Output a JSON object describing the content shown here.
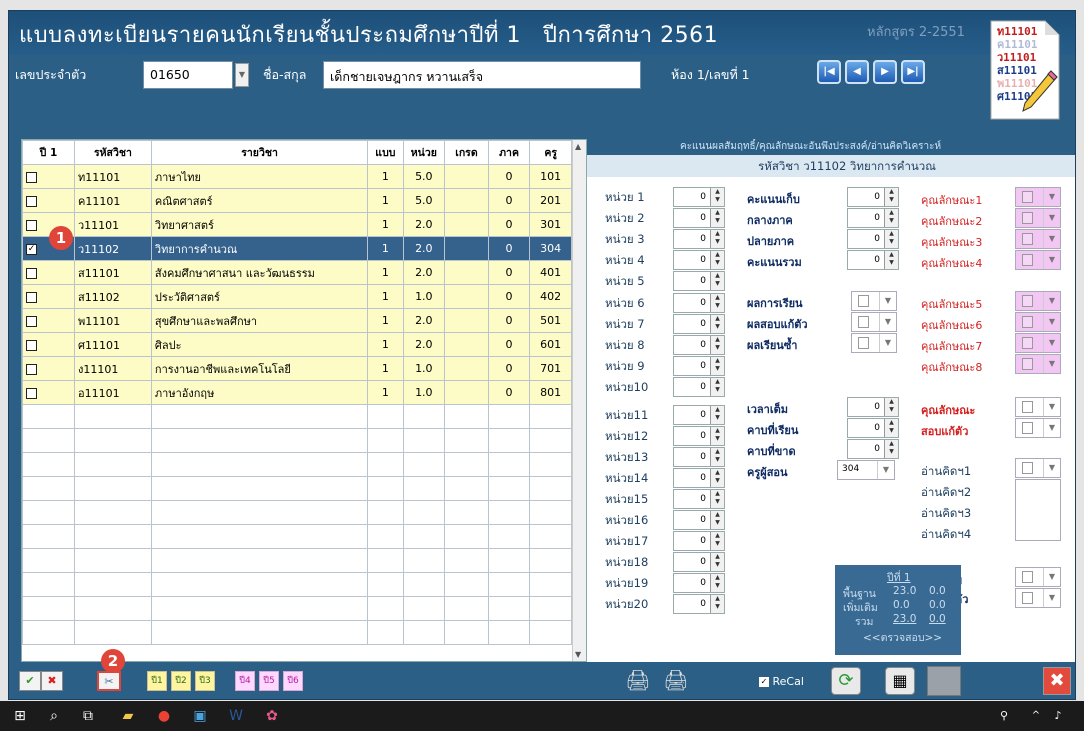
{
  "title": {
    "main": "แบบลงทะเบียนรายคนนักเรียนชั้นประถมศึกษาปีที่ 1",
    "year": "ปีการศึกษา 2561",
    "curriculum": "หลักสูตร 2-2551",
    "logo_lines": [
      "ท11101",
      "ค11101",
      "ว11101",
      "ส11101",
      "พ11101",
      "ศ11101"
    ]
  },
  "student": {
    "id_label": "เลขประจำตัว",
    "id_value": "01650",
    "name_label": "ชื่อ-สกุล",
    "name_value": "เด็กชายเจษฎากร  หวานเสร็จ",
    "room_text": "ห้อง 1/เลขที่ 1"
  },
  "nav": [
    "first",
    "prev",
    "next",
    "last"
  ],
  "grid": {
    "headers": [
      "ปี 1",
      "รหัสวิชา",
      "รายวิชา",
      "แบบ",
      "หน่วย",
      "เกรด",
      "ภาค",
      "ครู"
    ],
    "rows": [
      {
        "checked": false,
        "code": "ท11101",
        "name": "ภาษาไทย",
        "type": "1",
        "credit": "5.0",
        "grade": "",
        "term": "0",
        "teacher": "101"
      },
      {
        "checked": false,
        "code": "ค11101",
        "name": "คณิตศาสตร์",
        "type": "1",
        "credit": "5.0",
        "grade": "",
        "term": "0",
        "teacher": "201"
      },
      {
        "checked": false,
        "code": "ว11101",
        "name": "วิทยาศาสตร์",
        "type": "1",
        "credit": "2.0",
        "grade": "",
        "term": "0",
        "teacher": "301"
      },
      {
        "checked": true,
        "code": "ว11102",
        "name": "วิทยาการคำนวณ",
        "type": "1",
        "credit": "2.0",
        "grade": "",
        "term": "0",
        "teacher": "304"
      },
      {
        "checked": false,
        "code": "ส11101",
        "name": "สังคมศึกษาศาสนา และวัฒนธรรม",
        "type": "1",
        "credit": "2.0",
        "grade": "",
        "term": "0",
        "teacher": "401"
      },
      {
        "checked": false,
        "code": "ส11102",
        "name": "ประวัติศาสตร์",
        "type": "1",
        "credit": "1.0",
        "grade": "",
        "term": "0",
        "teacher": "402"
      },
      {
        "checked": false,
        "code": "พ11101",
        "name": "สุขศึกษาและพลศึกษา",
        "type": "1",
        "credit": "2.0",
        "grade": "",
        "term": "0",
        "teacher": "501"
      },
      {
        "checked": false,
        "code": "ศ11101",
        "name": "ศิลปะ",
        "type": "1",
        "credit": "2.0",
        "grade": "",
        "term": "0",
        "teacher": "601"
      },
      {
        "checked": false,
        "code": "ง11101",
        "name": "การงานอาชีพและเทคโนโลยี",
        "type": "1",
        "credit": "1.0",
        "grade": "",
        "term": "0",
        "teacher": "701"
      },
      {
        "checked": false,
        "code": "อ11101",
        "name": "ภาษาอังกฤษ",
        "type": "1",
        "credit": "1.0",
        "grade": "",
        "term": "0",
        "teacher": "801"
      }
    ],
    "empty_rows": 10,
    "selected_row": 3
  },
  "callouts": {
    "one": "1",
    "two": "2"
  },
  "detail": {
    "header": "คะแนนผลสัมฤทธิ์/คุณลักษณะอันพึงประสงค์/อ่านคิดวิเคราะห์",
    "subject": "รหัสวิชา ว11102   วิทยาการคำนวณ",
    "units": [
      {
        "label": "หน่วย 1",
        "value": "0"
      },
      {
        "label": "หน่วย 2",
        "value": "0"
      },
      {
        "label": "หน่วย 3",
        "value": "0"
      },
      {
        "label": "หน่วย 4",
        "value": "0"
      },
      {
        "label": "หน่วย 5",
        "value": "0"
      },
      {
        "label": "หน่วย 6",
        "value": "0"
      },
      {
        "label": "หน่วย 7",
        "value": "0"
      },
      {
        "label": "หน่วย 8",
        "value": "0"
      },
      {
        "label": "หน่วย 9",
        "value": "0"
      },
      {
        "label": "หน่วย10",
        "value": "0"
      },
      {
        "label": "หน่วย11",
        "value": "0"
      },
      {
        "label": "หน่วย12",
        "value": "0"
      },
      {
        "label": "หน่วย13",
        "value": "0"
      },
      {
        "label": "หน่วย14",
        "value": "0"
      },
      {
        "label": "หน่วย15",
        "value": "0"
      },
      {
        "label": "หน่วย16",
        "value": "0"
      },
      {
        "label": "หน่วย17",
        "value": "0"
      },
      {
        "label": "หน่วย18",
        "value": "0"
      },
      {
        "label": "หน่วย19",
        "value": "0"
      },
      {
        "label": "หน่วย20",
        "value": "0"
      }
    ],
    "scores": [
      {
        "label": "คะแนนเก็บ",
        "value": "0"
      },
      {
        "label": "กลางภาค",
        "value": "0"
      },
      {
        "label": "ปลายภาค",
        "value": "0"
      },
      {
        "label": "คะแนนรวม",
        "value": "0"
      }
    ],
    "results": [
      {
        "label": "ผลการเรียน"
      },
      {
        "label": "ผลสอบแก้ตัว"
      },
      {
        "label": "ผลเรียนซ้ำ"
      }
    ],
    "time": [
      {
        "label": "เวลาเต็ม",
        "value": "0"
      },
      {
        "label": "คาบที่เรียน",
        "value": "0"
      },
      {
        "label": "คาบที่ขาด",
        "value": "0"
      }
    ],
    "teacher_label": "ครูผู้สอน",
    "teacher_value": "304",
    "traits": [
      "คุณลักษณะ1",
      "คุณลักษณะ2",
      "คุณลักษณะ3",
      "คุณลักษณะ4",
      "คุณลักษณะ5",
      "คุณลักษณะ6",
      "คุณลักษณะ7",
      "คุณลักษณะ8"
    ],
    "trait_total": "คุณลักษณะ",
    "trait_retest": "สอบแก้ตัว",
    "reading": [
      "อ่านคิดฯ1",
      "อ่านคิดฯ2",
      "อ่านคิดฯ3",
      "อ่านคิดฯ4"
    ],
    "reading_total": "อ่านคิดฯ",
    "reading_retest": "สอบแก้ตัว",
    "summary": {
      "year": "ปีที่ 1",
      "basic_label": "พื้นฐาน",
      "basic_value": "23.0",
      "basic_extra": "0.0",
      "addl_label": "เพิ่มเติม",
      "addl_value": "0.0",
      "addl_extra": "0.0",
      "total_label": "รวม",
      "total_value": "23.0",
      "total_extra": "0.0",
      "check": "<<ตรวจสอบ>>"
    }
  },
  "toolbar": {
    "years": [
      "ปี1",
      "ปี2",
      "ปี3",
      "ปี4",
      "ปี5",
      "ปี6"
    ],
    "recal_label": "ReCal"
  },
  "colors": {
    "frame": "#2c5f86",
    "row_yellow": "#fdfbc6",
    "row_selected": "#35628d",
    "callout": "#e0453a",
    "trait_red": "#d62020"
  }
}
